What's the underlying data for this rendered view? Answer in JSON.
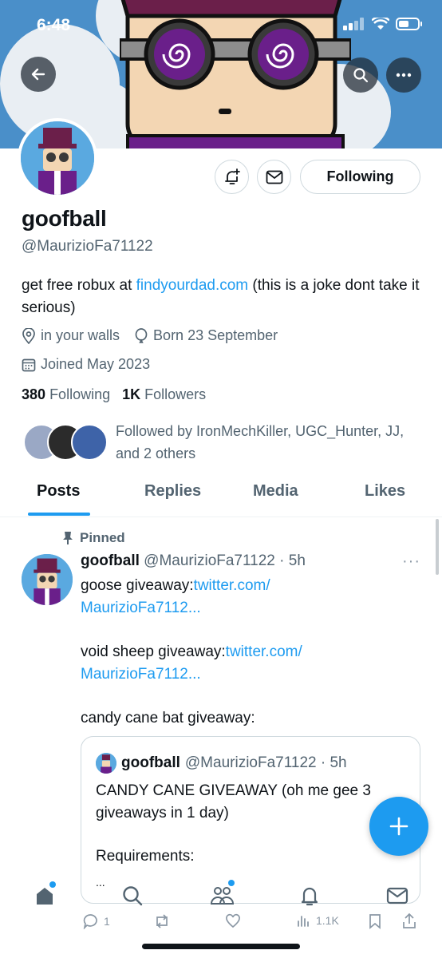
{
  "status_bar": {
    "time": "6:48"
  },
  "profile": {
    "display_name": "goofball",
    "handle": "@MaurizioFa71122",
    "bio_prefix": "get free robux at ",
    "bio_link": "findyourdad.com",
    "bio_suffix": " (this is a joke dont take it serious)",
    "location": "in your walls",
    "birthday": "Born 23 September",
    "joined": "Joined May 2023",
    "following_count": "380",
    "following_label": "Following",
    "followers_count": "1K",
    "followers_label": "Followers",
    "followed_by": "Followed by IronMechKiller, UGC_Hunter, JJ, and 2 others",
    "follow_button_label": "Following"
  },
  "tabs": [
    {
      "label": "Posts",
      "active": true
    },
    {
      "label": "Replies",
      "active": false
    },
    {
      "label": "Media",
      "active": false
    },
    {
      "label": "Likes",
      "active": false
    }
  ],
  "post": {
    "pinned_label": "Pinned",
    "author_name": "goofball",
    "author_handle": "@MaurizioFa71122",
    "time": "· 5h",
    "line1_text": "goose giveaway:",
    "line1_link": "twitter.com/",
    "line1_link2": "MaurizioFa7112...",
    "line2_text": "void sheep giveaway:",
    "line2_link": "twitter.com/",
    "line2_link2": "MaurizioFa7112...",
    "line3_text": "candy cane bat giveaway:",
    "quote": {
      "author_name": "goofball",
      "author_handle": "@MaurizioFa71122",
      "time": "· 5h",
      "text": "CANDY CANE GIVEAWAY (oh me gee 3 giveaways in 1 day)",
      "requirements": "Requirements:",
      "more": "..."
    },
    "reply_count": "1",
    "views_count": "1.1K"
  },
  "colors": {
    "accent": "#1d9bf0",
    "banner": "#4a8fc9",
    "muted": "#536471"
  },
  "icons": {
    "back": "back-arrow-icon",
    "search": "search-icon",
    "more": "more-icon",
    "notify": "bell-plus-icon",
    "message": "envelope-icon",
    "compose": "plus-icon"
  }
}
